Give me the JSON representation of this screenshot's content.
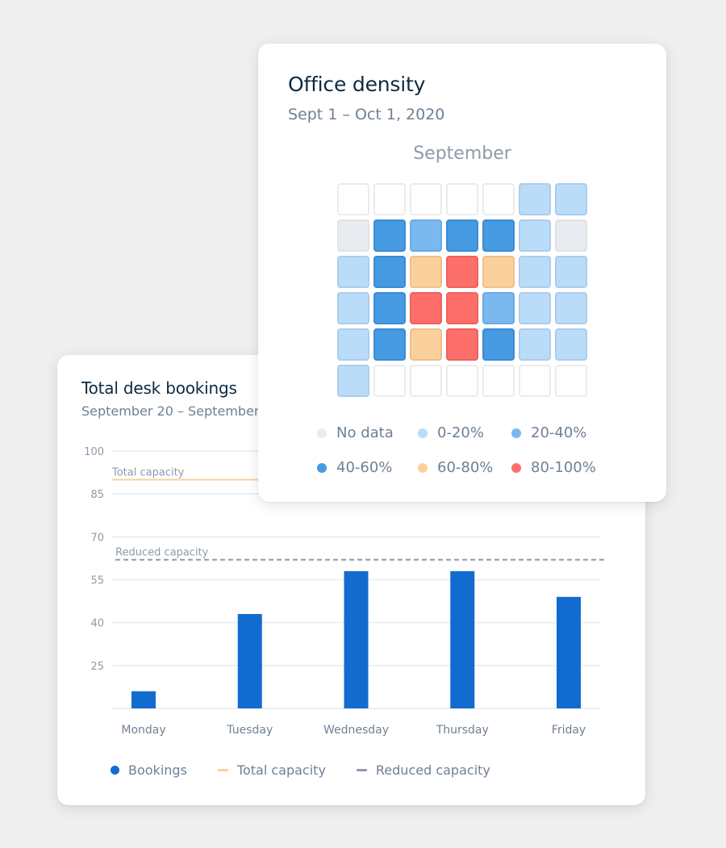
{
  "bookings_card": {
    "title": "Total desk bookings",
    "subtitle": "September 20 – September",
    "legend": [
      {
        "label": "Bookings",
        "color": "#126bcf",
        "marker": "dot"
      },
      {
        "label": "Total capacity",
        "color": "#fbcf9b",
        "marker": "line"
      },
      {
        "label": "Reduced capacity",
        "color": "#8e9aab",
        "marker": "dash"
      }
    ]
  },
  "density_card": {
    "title": "Office density",
    "subtitle": "Sept 1 – Oct 1, 2020",
    "month": "September",
    "legend": [
      {
        "label": "No data",
        "key": "nodata",
        "color": "#e8ecf0"
      },
      {
        "label": "0-20%",
        "key": "0-20",
        "color": "#bbdcf8"
      },
      {
        "label": "20-40%",
        "key": "20-40",
        "color": "#7ab8f0"
      },
      {
        "label": "40-60%",
        "key": "40-60",
        "color": "#469ae2"
      },
      {
        "label": "60-80%",
        "key": "60-80",
        "color": "#fcd09c"
      },
      {
        "label": "80-100%",
        "key": "80-100",
        "color": "#fd6f6b"
      }
    ]
  },
  "chart_data": [
    {
      "type": "bar",
      "title": "Total desk bookings",
      "subtitle": "September 20 – September",
      "categories": [
        "Monday",
        "Tuesday",
        "Wednesday",
        "Thursday",
        "Friday"
      ],
      "series": [
        {
          "name": "Bookings",
          "values": [
            16,
            43,
            58,
            58,
            49
          ],
          "color": "#126bcf"
        }
      ],
      "reference_lines": [
        {
          "name": "Total capacity",
          "value": 90,
          "style": "solid",
          "color": "#fbcf9b",
          "label": "Total capacity"
        },
        {
          "name": "Reduced capacity",
          "value": 62,
          "style": "dashed",
          "color": "#8e9aab",
          "label": "Reduced capacity"
        }
      ],
      "yticks": [
        100,
        85,
        70,
        55,
        40,
        25
      ],
      "ylim": [
        10,
        100
      ],
      "xlabel": "",
      "ylabel": "",
      "grid": true,
      "legend_position": "bottom-left"
    },
    {
      "type": "heatmap",
      "title": "Office density",
      "subtitle": "Sept 1 – Oct 1, 2020",
      "month": "September",
      "columns": 7,
      "rows": [
        [
          "empty",
          "empty",
          "empty",
          "empty",
          "empty",
          "0-20",
          "0-20"
        ],
        [
          "nodata",
          "40-60",
          "20-40",
          "40-60",
          "40-60",
          "0-20",
          "nodata"
        ],
        [
          "0-20",
          "40-60",
          "60-80",
          "80-100",
          "60-80",
          "0-20",
          "0-20"
        ],
        [
          "0-20",
          "40-60",
          "80-100",
          "80-100",
          "20-40",
          "0-20",
          "0-20"
        ],
        [
          "0-20",
          "40-60",
          "60-80",
          "80-100",
          "40-60",
          "0-20",
          "0-20"
        ],
        [
          "0-20",
          "empty",
          "empty",
          "empty",
          "empty",
          "empty",
          "empty"
        ]
      ],
      "legend_position": "bottom"
    }
  ]
}
